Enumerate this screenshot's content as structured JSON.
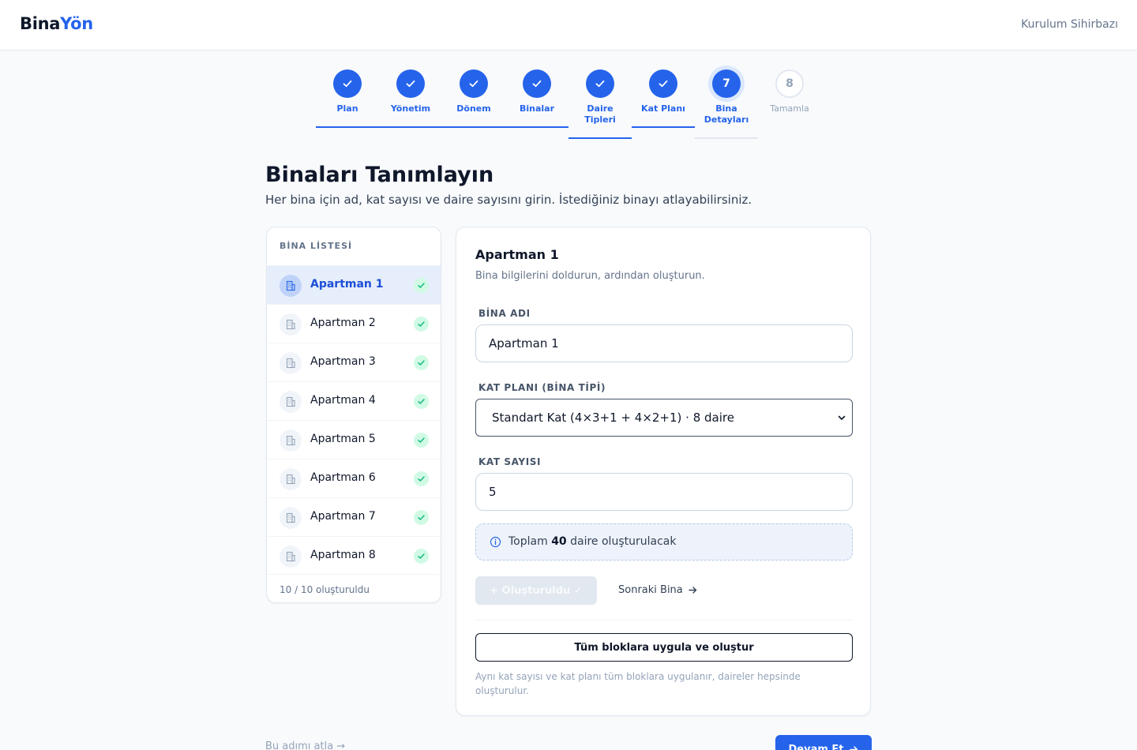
{
  "header": {
    "brand_part1": "Bina",
    "brand_part2": "Yön",
    "wizard_label": "Kurulum Sihirbazı"
  },
  "steps": [
    {
      "label": "Plan",
      "state": "done"
    },
    {
      "label": "Yönetim",
      "state": "done"
    },
    {
      "label": "Dönem",
      "state": "done"
    },
    {
      "label": "Binalar",
      "state": "done"
    },
    {
      "label": "Daire Tipleri",
      "state": "done"
    },
    {
      "label": "Kat Planı",
      "state": "done"
    },
    {
      "label": "Bina Detayları",
      "number": "7",
      "state": "active"
    },
    {
      "label": "Tamamla",
      "number": "8",
      "state": "todo"
    }
  ],
  "page": {
    "title": "Binaları Tanımlayın",
    "subtitle": "Her bina için ad, kat sayısı ve daire sayısını girin. İstediğiniz binayı atlayabilirsiniz."
  },
  "building_list": {
    "heading": "BİNA LİSTESİ",
    "items": [
      {
        "name": "Apartman 1",
        "selected": true
      },
      {
        "name": "Apartman 2"
      },
      {
        "name": "Apartman 3"
      },
      {
        "name": "Apartman 4"
      },
      {
        "name": "Apartman 5"
      },
      {
        "name": "Apartman 6"
      },
      {
        "name": "Apartman 7"
      },
      {
        "name": "Apartman 8"
      }
    ],
    "footer": "10 / 10 oluşturuldu"
  },
  "form": {
    "title": "Apartman 1",
    "subtitle": "Bina bilgilerini doldurun, ardından oluşturun.",
    "name_label": "BİNA ADI",
    "name_value": "Apartman 1",
    "plan_label": "KAT PLANI (BİNA TİPİ)",
    "plan_value": "Standart Kat (4×3+1 + 4×2+1) · 8 daire",
    "floors_label": "KAT SAYISI",
    "floors_value": "5",
    "info_prefix": "Toplam",
    "info_count": "40",
    "info_suffix": "daire oluşturulacak",
    "created_button": "+ Oluşturuldu ✓",
    "next_button": "Sonraki Bina",
    "apply_button": "Tüm bloklara uygula ve oluştur",
    "apply_note": "Aynı kat sayısı ve kat planı tüm bloklara uygulanır, daireler hepsinde oluşturulur."
  },
  "footer": {
    "skip": "Bu adımı atla →",
    "continue": "Devam Et"
  },
  "colors": {
    "accent": "#2563eb",
    "success": "#10b981",
    "success_bg": "#d1fae5",
    "text": "#0f172a",
    "muted": "#64748b"
  }
}
